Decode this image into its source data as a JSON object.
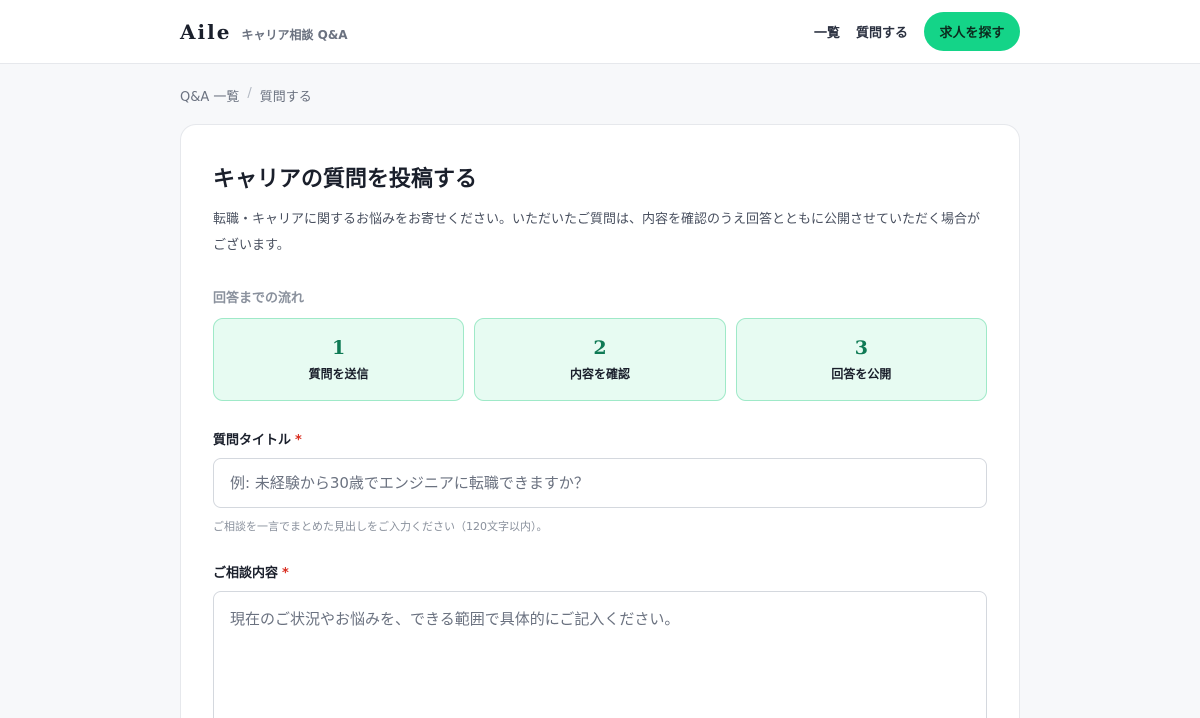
{
  "header": {
    "logo": "Aile",
    "tagline": "キャリア相談 Q&A",
    "nav": {
      "list_label": "一覧",
      "ask_label": "質問する"
    },
    "cta_label": "求人を探す"
  },
  "breadcrumb": {
    "home": "Q&A 一覧",
    "separator": "/",
    "current": "質問する"
  },
  "form": {
    "title": "キャリアの質問を投稿する",
    "description": "転職・キャリアに関するお悩みをお寄せください。いただいたご質問は、内容を確認のうえ回答とともに公開させていただく場合がございます。",
    "flow_label": "回答までの流れ",
    "steps": [
      {
        "num": "1",
        "label": "質問を送信"
      },
      {
        "num": "2",
        "label": "内容を確認"
      },
      {
        "num": "3",
        "label": "回答を公開"
      }
    ],
    "title_field": {
      "label": "質問タイトル",
      "required": "*",
      "placeholder": "例: 未経験から30歳でエンジニアに転職できますか？",
      "hint": "ご相談を一言でまとめた見出しをご入力ください（120文字以内）。"
    },
    "body_field": {
      "label": "ご相談内容",
      "required": "*",
      "placeholder": "現在のご状況やお悩みを、できる範囲で具体的にご記入ください。"
    }
  },
  "colors": {
    "accent": "#14d488",
    "step_bg": "#e7fbf2",
    "required": "#d92d20"
  }
}
